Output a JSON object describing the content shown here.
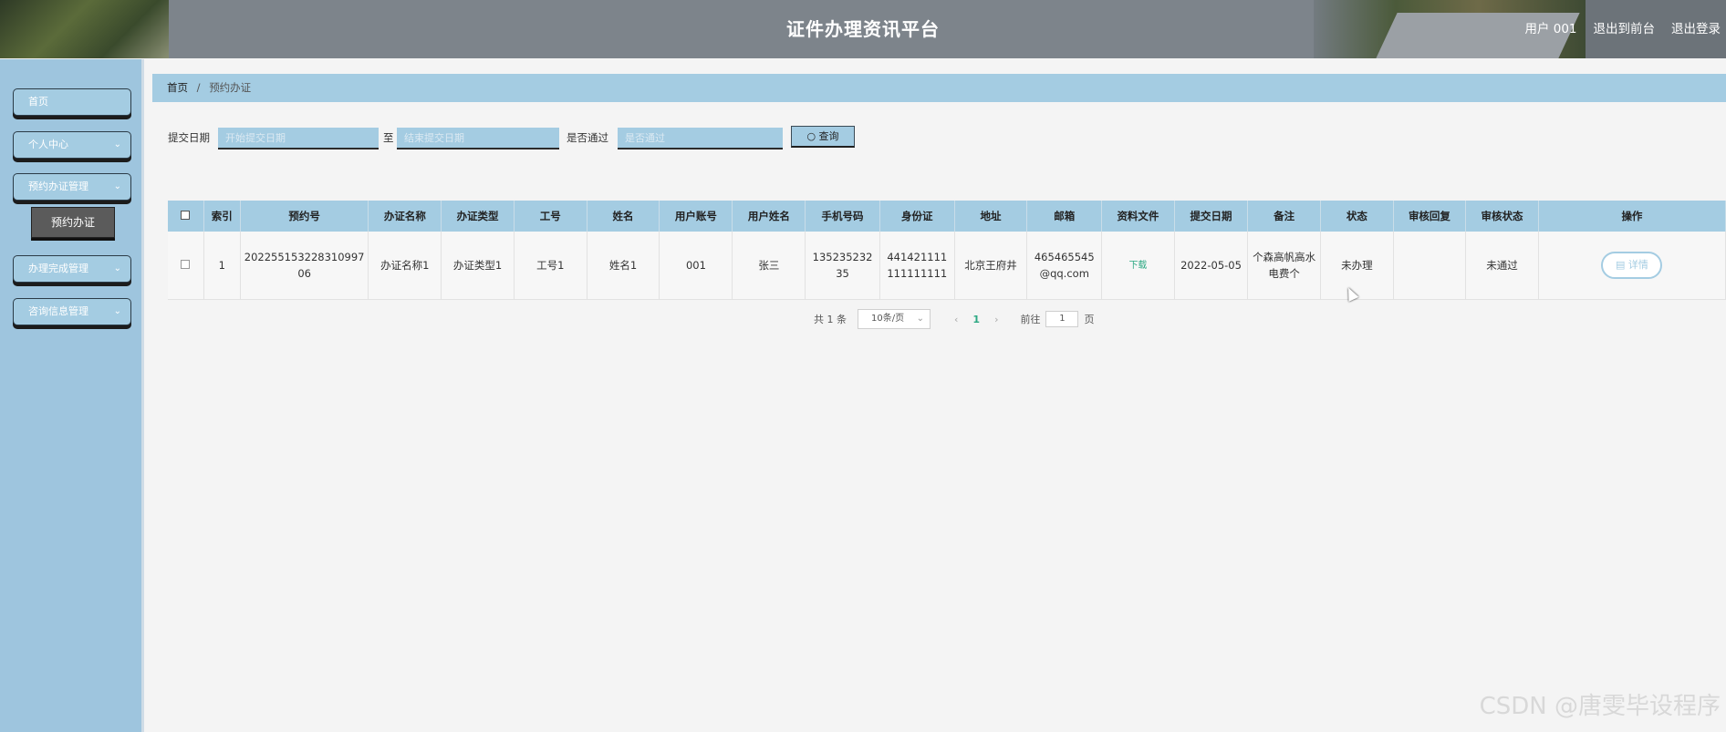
{
  "header": {
    "title": "证件办理资讯平台",
    "user": "用户 001",
    "back_front": "退出到前台",
    "logout": "退出登录"
  },
  "sidebar": {
    "items": [
      {
        "label": "首页"
      },
      {
        "label": "个人中心"
      },
      {
        "label": "预约办证管理"
      },
      {
        "label": "办理完成管理"
      },
      {
        "label": "咨询信息管理"
      }
    ],
    "sub_item": "预约办证"
  },
  "breadcrumb": {
    "home": "首页",
    "current": "预约办证"
  },
  "search": {
    "date_label": "提交日期",
    "to_label": "至",
    "start_placeholder": "开始提交日期",
    "end_placeholder": "结束提交日期",
    "pass_label": "是否通过",
    "pass_placeholder": "是否通过",
    "query_btn": "查询"
  },
  "table": {
    "headers": [
      "",
      "索引",
      "预约号",
      "办证名称",
      "办证类型",
      "工号",
      "姓名",
      "用户账号",
      "用户姓名",
      "手机号码",
      "身份证",
      "地址",
      "邮箱",
      "资料文件",
      "提交日期",
      "备注",
      "状态",
      "审核回复",
      "审核状态",
      "操作"
    ],
    "rows": [
      {
        "index": "1",
        "appt_no": "202255153228310997 06",
        "cert_name": "办证名称1",
        "cert_type": "办证类型1",
        "job_no": "工号1",
        "name": "姓名1",
        "account": "001",
        "user_name": "张三",
        "phone": "135235232 35",
        "id_card": "441421111 111111111",
        "address": "北京王府井",
        "email": "465465545 @qq.com",
        "file": "下载",
        "date": "2022-05-05",
        "remark": "个森高帆高水电费个",
        "status": "未办理",
        "reply": "",
        "audit": "未通过",
        "action": "详情"
      }
    ]
  },
  "pagination": {
    "total": "共 1 条",
    "page_size": "10条/页",
    "current": "1",
    "goto": "前往",
    "goto_value": "1",
    "page_unit": "页"
  },
  "watermark": "CSDN @唐雯毕设程序"
}
